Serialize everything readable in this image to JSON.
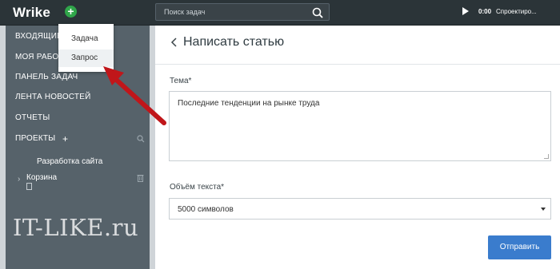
{
  "app": {
    "logo": "Wrike",
    "add_symbol": "+"
  },
  "search": {
    "placeholder": "Поиск задач"
  },
  "timer": {
    "time": "0:00",
    "label": "Спроектиро..."
  },
  "sidebar": {
    "items": [
      {
        "label": "ВХОДЯЩИЕ"
      },
      {
        "label": "МОЯ РАБО..."
      },
      {
        "label": "ПАНЕЛЬ ЗАДАЧ"
      },
      {
        "label": "ЛЕНТА НОВОСТЕЙ"
      },
      {
        "label": "ОТЧЕТЫ"
      },
      {
        "label": "ПРОЕКТЫ"
      }
    ],
    "projects_plus": "+",
    "subitems": [
      {
        "label": "Разработка сайта"
      },
      {
        "label": "Корзина"
      }
    ]
  },
  "menu": {
    "items": [
      {
        "label": "Задача"
      },
      {
        "label": "Запрос"
      }
    ]
  },
  "form": {
    "title": "Написать статью",
    "topic_label": "Тема*",
    "topic_value": "Последние тенденции на рынке труда",
    "volume_label": "Объём текста*",
    "volume_value": "5000 символов",
    "submit_label": "Отправить"
  },
  "watermark": "IT-LIKE.ru",
  "colors": {
    "accent_blue": "#3a7ccd",
    "add_green": "#30a64a",
    "annotation_red": "#c0161a",
    "sidebar": "#56626a",
    "topbar": "#2b3438"
  }
}
